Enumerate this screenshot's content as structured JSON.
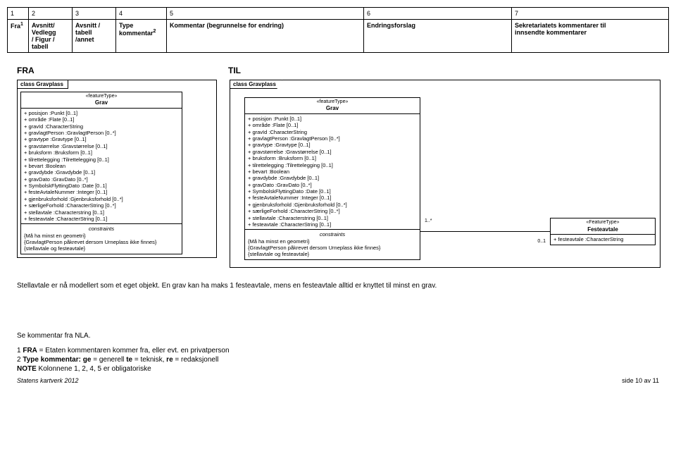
{
  "table": {
    "cols": [
      "1",
      "2",
      "3",
      "4",
      "5",
      "6",
      "7"
    ],
    "h1": "Fra",
    "h1sup": "1",
    "h2a": "Avsnitt/",
    "h2b": "Vedlegg",
    "h2c": "/ Figur /",
    "h2d": "tabell",
    "h3a": "Avsnitt /",
    "h3b": "tabell",
    "h3c": "/annet",
    "h4a": "Type",
    "h4b": "kommentar",
    "h4sup": "2",
    "h5": "Kommentar (begrunnelse for endring)",
    "h6": "Endringsforslag",
    "h7a": "Sekretariatets kommentarer til",
    "h7b": "innsendte kommentarer"
  },
  "labels": {
    "fra": "FRA",
    "til": "TIL"
  },
  "left": {
    "pkg": "class Gravplass",
    "stereo": "«featureType»",
    "cname": "Grav",
    "attrs": [
      "+   posisjon :Punkt [0..1]",
      "+   område :Flate [0..1]",
      "+   gravId :CharacterString",
      "+   gravlagtPerson :GravlagtPerson [0..*]",
      "+   gravtype :Gravtype [0..1]",
      "+   gravstørrelse :Gravstørrelse [0..1]",
      "+   bruksform :Bruksform [0..1]",
      "+   tilrettelegging :Tilrettelegging [0..1]",
      "+   bevart :Boolean",
      "+   gravdybde :Gravdybde [0..1]",
      "+   gravDato :GravDato [0..*]",
      "+   SymbolskFlyttingDato :Date [0..1]",
      "+   festeAvtaleNummer :Integer [0..1]",
      "+   gjenbruksforhold :Gjenbruksforhold [0..*]",
      "+   særligeForhold :CharacterString [0..*]",
      "+   stellavtale :Characterstring [0..1]",
      "+   festeavtale :CharacterString [0..1]"
    ],
    "ctitle": "constraints",
    "constraints": [
      "{Må ha minst en geometri}",
      "{GravlagtPerson påkrevet dersom Urneplass ikke finnes}",
      "{stellavtale og festeavtale}"
    ]
  },
  "right": {
    "pkg": "class Gravplass",
    "grav": {
      "stereo": "«featureType»",
      "cname": "Grav",
      "attrs": [
        "+   posisjon :Punkt [0..1]",
        "+   område :Flate [0..1]",
        "+   gravId :CharacterString",
        "+   gravlagtPerson :GravlagtPerson [0..*]",
        "+   gravtype :Gravtype [0..1]",
        "+   gravstørrelse :Gravstørrelse [0..1]",
        "+   bruksform :Bruksform [0..1]",
        "+   tilrettelegging :Tilrettelegging [0..1]",
        "+   bevart :Boolean",
        "+   gravdybde :Gravdybde [0..1]",
        "+   gravDato :GravDato [0..*]",
        "+   SymbolskFlyttingDato :Date [0..1]",
        "+   festeAvtaleNummer :Integer [0..1]",
        "+   gjenbruksforhold :Gjenbruksforhold [0..*]",
        "+   særligeForhold :CharacterString [0..*]",
        "+   stellavtale :Characterstring [0..1]",
        "+   festeavtale :CharacterString [0..1]"
      ],
      "ctitle": "constraints",
      "constraints": [
        "{Må ha minst en geometri}",
        "{GravlagtPerson påkrevet dersom Urneplass ikke finnes}",
        "{stellavtale og festeavtale}"
      ]
    },
    "mult_left": "1..*",
    "mult_right": "0..1",
    "feste": {
      "stereo": "«FeatureType»",
      "cname": "Festeavtale",
      "attr": "+   festeavtale :CharacterString"
    }
  },
  "body_text": "Stellavtale er nå modellert som et eget objekt. En grav kan ha maks 1 festeavtale, mens en festeavtale alltid er knyttet til minst en grav.",
  "see_comment": "Se kommentar fra NLA.",
  "foot": {
    "l1a": "1   ",
    "l1b": "FRA",
    "l1c": " = Etaten kommentaren kommer fra, eller evt. en privatperson",
    "l2a": "2   ",
    "l2b": "Type kommentar:",
    "l2c": "       ",
    "l2d": "ge",
    "l2e": " = generell  ",
    "l2f": "te",
    "l2g": " = teknisk,  ",
    "l2h": "re",
    "l2i": " = redaksjonell",
    "l3a": "NOTE",
    "l3b": " Kolonnene 1, 2, 4, 5 er obligatoriske",
    "publisher": "Statens kartverk 2012",
    "page": "side 10 av 11"
  }
}
